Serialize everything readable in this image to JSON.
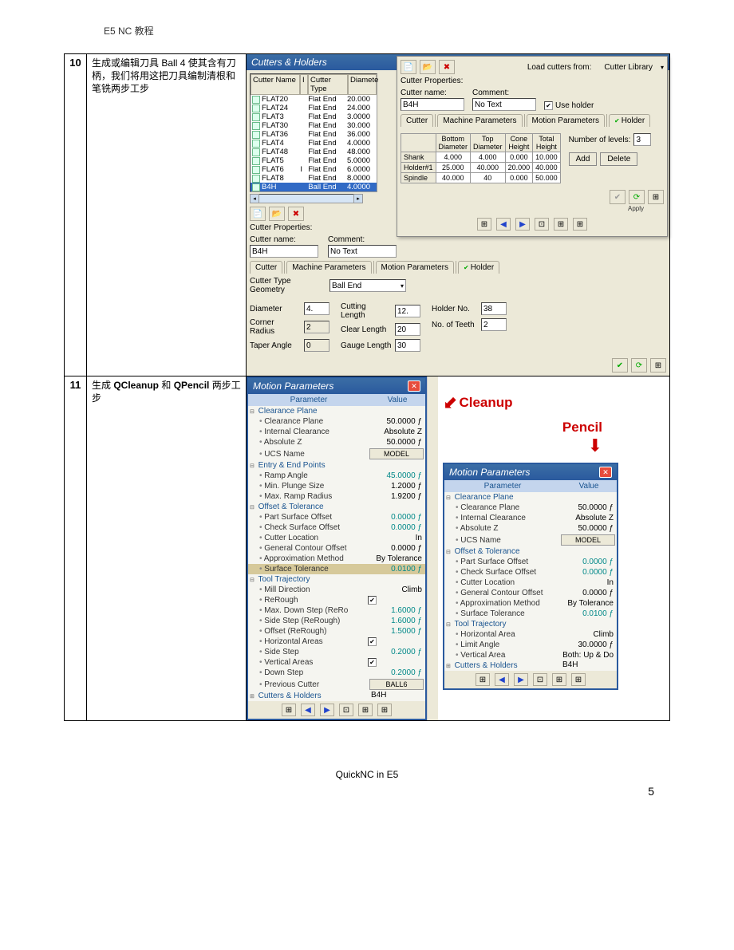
{
  "header": {
    "title": "E5 NC 教程"
  },
  "footer": {
    "text": "QuickNC in E5",
    "page": "5"
  },
  "steps": {
    "s10": {
      "num": "10",
      "text_parts": [
        "生成或编辑刀具 ",
        "Ball 4",
        " 使其含有刀柄，我们将用这把刀具编制清根和笔铣两步工步"
      ]
    },
    "s11": {
      "num": "11",
      "text_parts": [
        "生成 ",
        "QCleanup",
        " 和 ",
        "QPencil",
        " 两步工步"
      ]
    }
  },
  "cutters_window": {
    "title": "Cutters & Holders",
    "list_head": [
      "Cutter Name",
      "I",
      "Cutter Type",
      "Diamete"
    ],
    "rows": [
      {
        "name": "FLAT20",
        "type": "Flat End",
        "dia": "20.000"
      },
      {
        "name": "FLAT24",
        "type": "Flat End",
        "dia": "24.000"
      },
      {
        "name": "FLAT3",
        "type": "Flat End",
        "dia": "3.0000"
      },
      {
        "name": "FLAT30",
        "type": "Flat End",
        "dia": "30.000"
      },
      {
        "name": "FLAT36",
        "type": "Flat End",
        "dia": "36.000"
      },
      {
        "name": "FLAT4",
        "type": "Flat End",
        "dia": "4.0000"
      },
      {
        "name": "FLAT48",
        "type": "Flat End",
        "dia": "48.000"
      },
      {
        "name": "FLAT5",
        "type": "Flat End",
        "dia": "5.0000"
      },
      {
        "name": "FLAT6",
        "i": "I",
        "type": "Flat End",
        "dia": "6.0000"
      },
      {
        "name": "FLAT8",
        "type": "Flat End",
        "dia": "8.0000"
      },
      {
        "name": "B4H",
        "type": "Ball End",
        "dia": "4.0000"
      }
    ],
    "props_label": "Cutter Properties:",
    "cutter_name_label": "Cutter name:",
    "cutter_name_value": "B4H",
    "comment_label": "Comment:",
    "comment_value": "No Text",
    "tabs": [
      "Cutter",
      "Machine Parameters",
      "Motion Parameters",
      "Holder"
    ],
    "geom_label": "Cutter Type Geometry",
    "geom_value": "Ball End",
    "fields": {
      "diameter_l": "Diameter",
      "diameter_v": "4.",
      "corner_l": "Corner Radius",
      "corner_v": "2",
      "taper_l": "Taper Angle",
      "taper_v": "0",
      "cutlen_l": "Cutting Length",
      "cutlen_v": "12.",
      "clearlen_l": "Clear Length",
      "clearlen_v": "20",
      "gauge_l": "Gauge Length",
      "gauge_v": "30",
      "holderno_l": "Holder No.",
      "holderno_v": "38",
      "teeth_l": "No. of Teeth",
      "teeth_v": "2"
    }
  },
  "overlay": {
    "load_label": "Load cutters from:",
    "load_value": "Cutter Library",
    "props_label": "Cutter Properties:",
    "cutter_name_label": "Cutter name:",
    "cutter_name_value": "B4H",
    "comment_label": "Comment:",
    "comment_value": "No Text",
    "use_holder": "Use holder",
    "tabs": [
      "Cutter",
      "Machine Parameters",
      "Motion Parameters",
      "Holder"
    ],
    "grid_head": [
      "",
      "Bottom Diameter",
      "Top Diameter",
      "Cone Height",
      "Total Height"
    ],
    "grid_rows": [
      {
        "h": "Shank",
        "v": [
          "4.000",
          "4.000",
          "0.000",
          "10.000"
        ]
      },
      {
        "h": "Holder#1",
        "v": [
          "25.000",
          "40.000",
          "20.000",
          "40.000"
        ]
      },
      {
        "h": "Spindle",
        "v": [
          "40.000",
          "40",
          "0.000",
          "50.000"
        ]
      }
    ],
    "levels_label": "Number of levels:",
    "levels_value": "3",
    "add_btn": "Add",
    "delete_btn": "Delete",
    "apply_btn": "Apply"
  },
  "cleanup_label": "Cleanup",
  "pencil_label": "Pencil",
  "mp_title": "Motion Parameters",
  "mp_head": {
    "param": "Parameter",
    "value": "Value"
  },
  "cleanup": {
    "groups": [
      {
        "name": "Clearance Plane",
        "rows": [
          {
            "n": "Clearance Plane",
            "v": "50.0000",
            "f": true
          },
          {
            "n": "Internal Clearance",
            "v": "Absolute Z"
          },
          {
            "n": "Absolute Z",
            "v": "50.0000",
            "f": true
          },
          {
            "n": "UCS Name",
            "v": "MODEL",
            "btn": true
          }
        ]
      },
      {
        "name": "Entry & End Points",
        "rows": [
          {
            "n": "Ramp Angle",
            "v": "45.0000",
            "f": true,
            "green": true
          },
          {
            "n": "Min. Plunge Size",
            "v": "1.2000",
            "f": true
          },
          {
            "n": "Max. Ramp Radius",
            "v": "1.9200",
            "f": true
          }
        ]
      },
      {
        "name": "Offset & Tolerance",
        "rows": [
          {
            "n": "Part Surface Offset",
            "v": "0.0000",
            "f": true,
            "green": true
          },
          {
            "n": "Check Surface Offset",
            "v": "0.0000",
            "f": true,
            "green": true
          },
          {
            "n": "Cutter Location",
            "v": "In"
          },
          {
            "n": "General Contour Offset",
            "v": "0.0000",
            "f": true
          },
          {
            "n": "Approximation Method",
            "v": "By Tolerance"
          },
          {
            "n": "Surface Tolerance",
            "v": "0.0100",
            "f": true,
            "green": true,
            "hl": true
          }
        ]
      },
      {
        "name": "Tool Trajectory",
        "rows": [
          {
            "n": "Mill Direction",
            "v": "Climb"
          },
          {
            "n": "ReRough",
            "chk": true
          },
          {
            "n": "Max. Down Step (ReRo",
            "v": "1.6000",
            "f": true,
            "green": true
          },
          {
            "n": "Side Step (ReRough)",
            "v": "1.6000",
            "f": true,
            "green": true
          },
          {
            "n": "Offset (ReRough)",
            "v": "1.5000",
            "f": true,
            "green": true
          },
          {
            "n": "Horizontal Areas",
            "chk": true
          },
          {
            "n": "Side Step",
            "v": "0.2000",
            "f": true,
            "green": true
          },
          {
            "n": "Vertical Areas",
            "chk": true
          },
          {
            "n": "Down Step",
            "v": "0.2000",
            "f": true,
            "green": true
          },
          {
            "n": "Previous Cutter",
            "v": "BALL6",
            "btn": true
          }
        ]
      },
      {
        "name": "Cutters & Holders",
        "collapsed": true,
        "rows": [],
        "val": "B4H"
      }
    ]
  },
  "pencil": {
    "groups": [
      {
        "name": "Clearance Plane",
        "rows": [
          {
            "n": "Clearance Plane",
            "v": "50.0000",
            "f": true
          },
          {
            "n": "Internal Clearance",
            "v": "Absolute Z"
          },
          {
            "n": "Absolute Z",
            "v": "50.0000",
            "f": true
          },
          {
            "n": "UCS Name",
            "v": "MODEL",
            "btn": true
          }
        ]
      },
      {
        "name": "Offset & Tolerance",
        "rows": [
          {
            "n": "Part Surface Offset",
            "v": "0.0000",
            "f": true,
            "green": true
          },
          {
            "n": "Check Surface Offset",
            "v": "0.0000",
            "f": true,
            "green": true
          },
          {
            "n": "Cutter Location",
            "v": "In"
          },
          {
            "n": "General Contour Offset",
            "v": "0.0000",
            "f": true
          },
          {
            "n": "Approximation Method",
            "v": "By Tolerance"
          },
          {
            "n": "Surface Tolerance",
            "v": "0.0100",
            "f": true,
            "green": true
          }
        ]
      },
      {
        "name": "Tool Trajectory",
        "rows": [
          {
            "n": "Horizontal Area",
            "v": "Climb"
          },
          {
            "n": "Limit Angle",
            "v": "30.0000",
            "f": true
          },
          {
            "n": "Vertical Area",
            "v": "Both: Up & Do"
          }
        ]
      },
      {
        "name": "Cutters & Holders",
        "collapsed": true,
        "rows": [],
        "val": "B4H"
      }
    ]
  }
}
